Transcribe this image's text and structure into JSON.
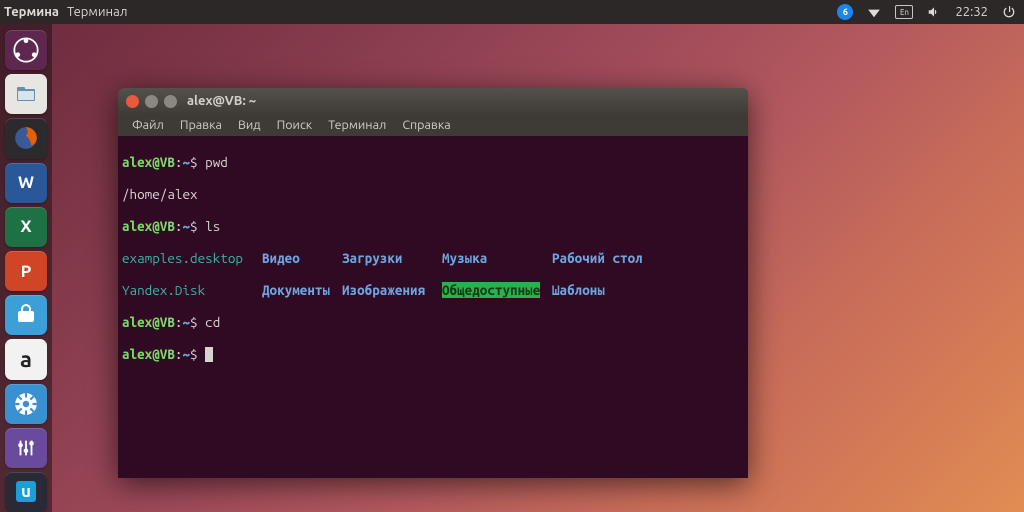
{
  "menubar": {
    "app_label_short": "Термина",
    "app_label": "Терминал",
    "keyboard_layout": "En",
    "time": "22:32"
  },
  "launcher": {
    "items": [
      {
        "name": "dash",
        "letter": ""
      },
      {
        "name": "files",
        "letter": ""
      },
      {
        "name": "firefox",
        "letter": ""
      },
      {
        "name": "word",
        "letter": "W"
      },
      {
        "name": "excel",
        "letter": "X"
      },
      {
        "name": "ppt",
        "letter": "P"
      },
      {
        "name": "software",
        "letter": ""
      },
      {
        "name": "amazon",
        "letter": "a"
      },
      {
        "name": "settings",
        "letter": ""
      },
      {
        "name": "eq",
        "letter": ""
      },
      {
        "name": "u",
        "letter": "u"
      }
    ]
  },
  "window": {
    "title": "alex@VB: ~",
    "menu": [
      "Файл",
      "Правка",
      "Вид",
      "Поиск",
      "Терминал",
      "Справка"
    ]
  },
  "terminal": {
    "prompt_user": "alex@VB",
    "prompt_sep": ":",
    "prompt_path": "~",
    "prompt_char": "$",
    "line1_cmd": "pwd",
    "line2_out": "/home/alex",
    "line3_cmd": "ls",
    "ls_rows": [
      {
        "c1": "examples.desktop",
        "c2": "Видео",
        "c3": "Загрузки",
        "c4": "Музыка",
        "c4_highlight": false,
        "c5": "Рабочий стол"
      },
      {
        "c1": "Yandex.Disk",
        "c2": "Документы",
        "c3": "Изображения",
        "c4": "Общедоступные",
        "c4_highlight": true,
        "c5": "Шаблоны"
      }
    ],
    "line6_cmd": "cd"
  }
}
